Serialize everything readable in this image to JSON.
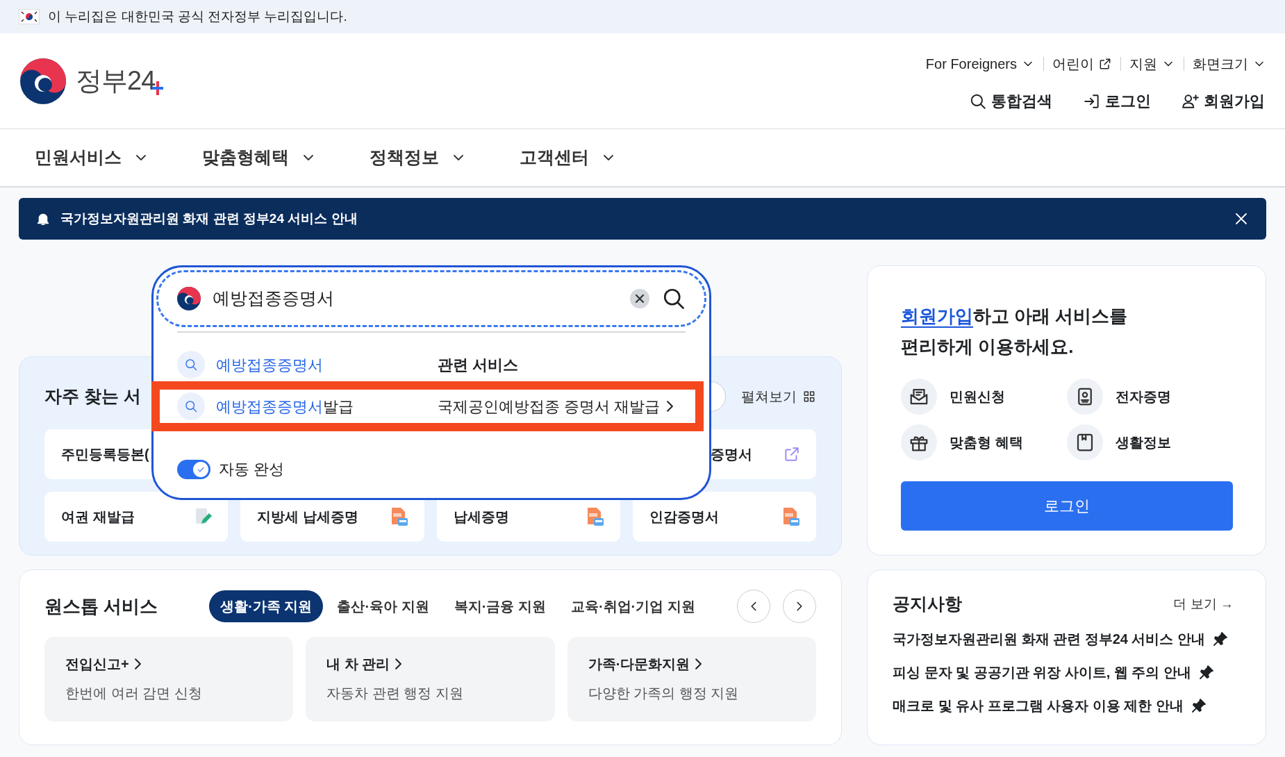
{
  "gov_banner": {
    "text": "이 누리집은 대한민국 공식 전자정부 누리집입니다."
  },
  "logo": {
    "text": "정부24"
  },
  "utility_links": [
    {
      "label": "For Foreigners",
      "kind": "dropdown"
    },
    {
      "label": "어린이",
      "kind": "external"
    },
    {
      "label": "지원",
      "kind": "dropdown"
    },
    {
      "label": "화면크기",
      "kind": "dropdown"
    }
  ],
  "header_actions": [
    {
      "label": "통합검색",
      "kind": "search"
    },
    {
      "label": "로그인",
      "kind": "login"
    },
    {
      "label": "회원가입",
      "kind": "signup"
    }
  ],
  "nav": [
    {
      "label": "민원서비스"
    },
    {
      "label": "맞춤형혜택"
    },
    {
      "label": "정책정보"
    },
    {
      "label": "고객센터"
    }
  ],
  "alert": {
    "text": "국가정보자원관리원 화재 관련 정부24 서비스 안내"
  },
  "search": {
    "value": "예방접종증명서",
    "suggestions": [
      {
        "match": "예방접종증명서",
        "highlighted": false
      },
      {
        "match": "예방접종증명서",
        "suffix": "발급",
        "highlighted": true
      }
    ],
    "related_heading": "관련 서비스",
    "related": [
      {
        "label": "국제공인예방접종 증명서 재발급"
      }
    ],
    "autocomplete": {
      "label": "자동 완성",
      "on": true
    }
  },
  "frequent": {
    "title": "자주 찾는 서",
    "expand_label": "펼쳐보기",
    "rows": [
      [
        {
          "label": "주민등록등본(",
          "kind": "plain"
        },
        {
          "label": "증명서",
          "kind": "external"
        }
      ],
      [
        {
          "label": "여권 재발급",
          "kind": "edit"
        },
        {
          "label": "지방세 납세증명",
          "kind": "pdf"
        },
        {
          "label": "납세증명",
          "kind": "pdf"
        },
        {
          "label": "인감증명서",
          "kind": "pdf"
        }
      ]
    ]
  },
  "member": {
    "link": "회원가입",
    "sentence": "하고 아래 서비스를\n편리하게 이용하세요.",
    "services": [
      {
        "label": "민원신청",
        "kind": "mail"
      },
      {
        "label": "전자증명",
        "kind": "id"
      },
      {
        "label": "맞춤형 혜택",
        "kind": "gift"
      },
      {
        "label": "생활정보",
        "kind": "book"
      }
    ],
    "login_button": "로그인"
  },
  "one_stop": {
    "title": "원스톱 서비스",
    "tabs": [
      {
        "label": "생활·가족 지원",
        "selected": true
      },
      {
        "label": "출산·육아 지원",
        "selected": false
      },
      {
        "label": "복지·금융 지원",
        "selected": false
      },
      {
        "label": "교육·취업·기업 지원",
        "selected": false
      }
    ],
    "cards": [
      {
        "title": "전입신고+",
        "description": "한번에 여러 감면 신청"
      },
      {
        "title": "내 차 관리",
        "description": "자동차 관련 행정 지원"
      },
      {
        "title": "가족·다문화지원",
        "description": "다양한 가족의 행정 지원"
      }
    ]
  },
  "notices": {
    "title": "공지사항",
    "more": "더 보기 →",
    "items": [
      {
        "text": "국가정보자원관리원 화재 관련 정부24 서비스 안내",
        "pinned": true
      },
      {
        "text": "피싱 문자 및 공공기관 위장 사이트, 웹 주의 안내",
        "pinned": true
      },
      {
        "text": "매크로 및 유사 프로그램 사용자 이용 제한 안내",
        "pinned": true
      }
    ]
  }
}
